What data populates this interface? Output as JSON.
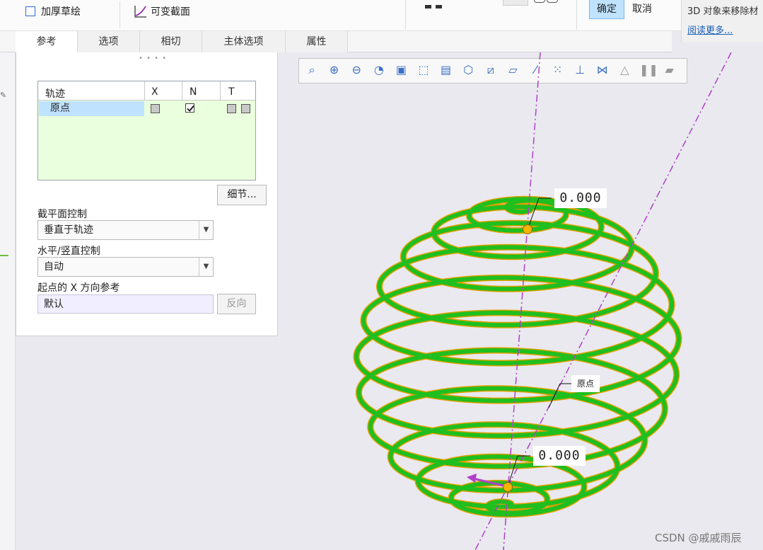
{
  "ribbon": {
    "thicken_sketch": "加厚草绘",
    "variable_section": "可变截面",
    "ok": "确定",
    "cancel": "取消"
  },
  "info_panel": {
    "message": "3D 对象来移除材",
    "read_more": "阅读更多..."
  },
  "tabs": [
    "参考",
    "选项",
    "相切",
    "主体选项",
    "属性"
  ],
  "trajectory_table": {
    "headers": [
      "轨迹",
      "X",
      "N",
      "T"
    ],
    "rows": [
      {
        "name": "原点",
        "x_checked": false,
        "n_checked": true
      }
    ]
  },
  "details_button": "细节...",
  "section_plane_control": {
    "label": "截平面控制",
    "value": "垂直于轨迹"
  },
  "horizontal_vertical_control": {
    "label": "水平/竖直控制",
    "value": "自动"
  },
  "start_x_reference": {
    "label": "起点的 X 方向参考",
    "value": "默认",
    "flip_button": "反向"
  },
  "viewport": {
    "dim_top": "0.000",
    "dim_bottom": "0.000",
    "origin_label": "原点",
    "toolbar_icons": [
      "refit-icon",
      "zoom-in-icon",
      "zoom-out-icon",
      "repaint-icon",
      "display-style-icon",
      "saved-views-icon",
      "view-manager-icon",
      "perspective-icon",
      "datum-display-icon",
      "plane-display-icon",
      "axis-display-icon",
      "point-display-icon",
      "csys-display-icon",
      "spin-center-icon",
      "annotation-icon",
      "pause-icon",
      "preview-icon"
    ]
  },
  "watermark": "CSDN @戚戚雨辰",
  "colors": {
    "spiral": "#1fbf1f",
    "spiral_edge": "#e0a000",
    "axis": "#b040c8",
    "selection": "#bfe3ff",
    "table_bg": "#eaffdd"
  }
}
